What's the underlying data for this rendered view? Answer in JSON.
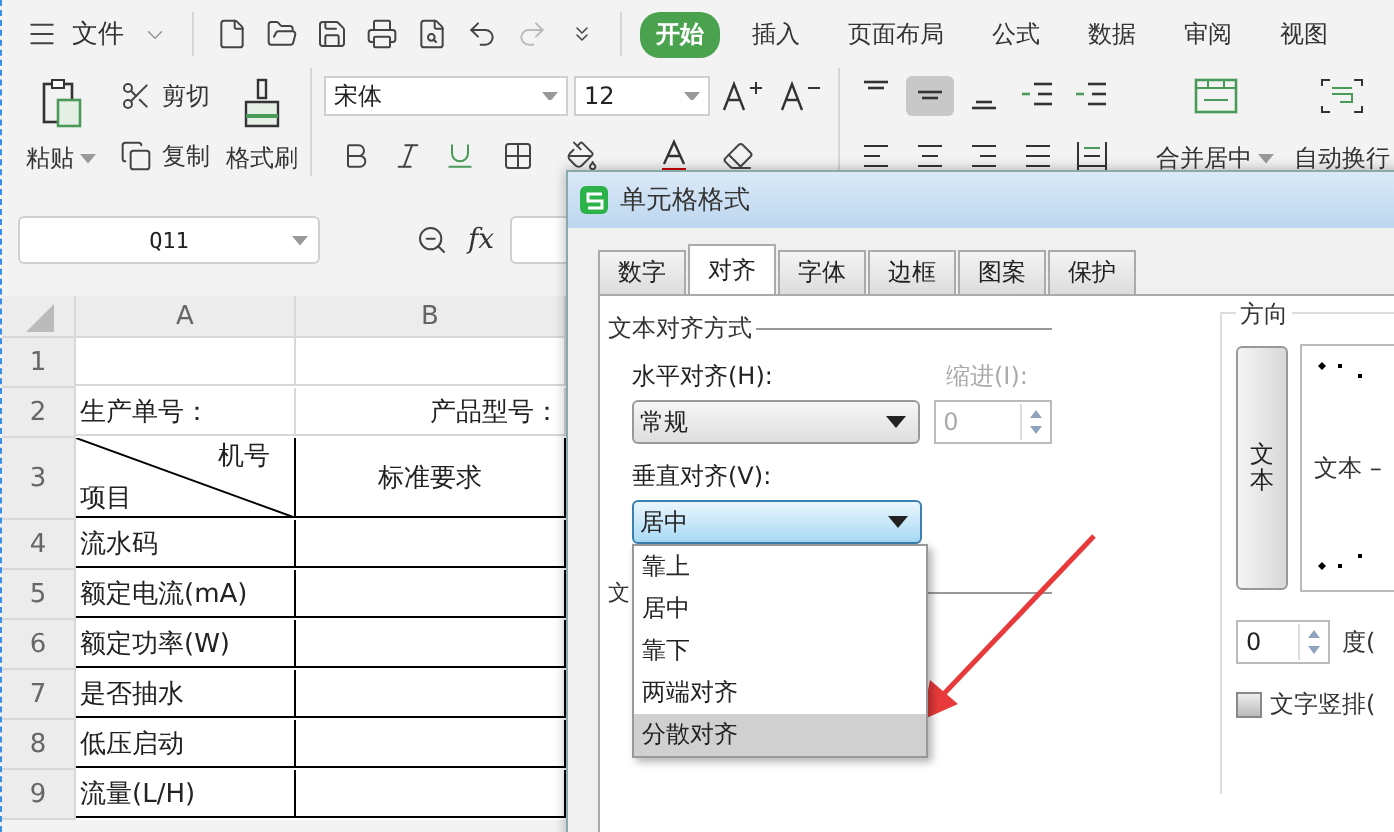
{
  "menu": {
    "file": "文件",
    "tabs": [
      {
        "label": "开始",
        "selected": true
      },
      {
        "label": "插入",
        "selected": false
      },
      {
        "label": "页面布局",
        "selected": false
      },
      {
        "label": "公式",
        "selected": false
      },
      {
        "label": "数据",
        "selected": false
      },
      {
        "label": "审阅",
        "selected": false
      },
      {
        "label": "视图",
        "selected": false
      }
    ]
  },
  "ribbon": {
    "paste": "粘贴",
    "cut": "剪切",
    "copy": "复制",
    "format_painter": "格式刷",
    "font_name": "宋体",
    "font_size": "12",
    "alignment": [
      {
        "kind": "top",
        "selected": false
      },
      {
        "kind": "middle",
        "selected": true
      },
      {
        "kind": "bottom",
        "selected": false
      },
      {
        "kind": "outdent",
        "selected": false
      },
      {
        "kind": "indent",
        "selected": false
      }
    ],
    "merge": "合并居中",
    "wrap": "自动换行"
  },
  "formula_bar": {
    "cell_ref": "Q11",
    "fx": "fx"
  },
  "sheet": {
    "columns": [
      "A",
      "B"
    ],
    "rows": [
      {
        "number": "1",
        "bordered": false
      },
      {
        "number": "2",
        "bordered": false,
        "a": "生产单号：",
        "b": "产品型号："
      },
      {
        "number": "3",
        "bordered": true,
        "kind": "diagonal",
        "a_top": "机号",
        "a_bottom": "项目",
        "b": "标准要求"
      },
      {
        "number": "4",
        "bordered": true,
        "a": "流水码"
      },
      {
        "number": "5",
        "bordered": true,
        "a": "额定电流(mA)"
      },
      {
        "number": "6",
        "bordered": true,
        "a": "额定功率(W)"
      },
      {
        "number": "7",
        "bordered": true,
        "a": "是否抽水"
      },
      {
        "number": "8",
        "bordered": true,
        "a": "低压启动"
      },
      {
        "number": "9",
        "bordered": true,
        "a": "流量(L/H)"
      }
    ]
  },
  "dialog": {
    "title": "单元格格式",
    "tabs": [
      {
        "label": "数字",
        "selected": false
      },
      {
        "label": "对齐",
        "selected": true
      },
      {
        "label": "字体",
        "selected": false
      },
      {
        "label": "边框",
        "selected": false
      },
      {
        "label": "图案",
        "selected": false
      },
      {
        "label": "保护",
        "selected": false
      }
    ],
    "text_alignment": {
      "heading": "文本对齐方式",
      "horizontal_label": "水平对齐(H):",
      "horizontal_value": "常规",
      "indent_label": "缩进(I):",
      "indent_value": "0",
      "indent_disabled": true,
      "vertical_label": "垂直对齐(V):",
      "vertical_value": "居中",
      "vertical_options": [
        {
          "label": "靠上",
          "selected": false
        },
        {
          "label": "居中",
          "selected": false
        },
        {
          "label": "靠下",
          "selected": false
        },
        {
          "label": "两端对齐",
          "selected": false
        },
        {
          "label": "分散对齐",
          "selected": true
        }
      ]
    },
    "text_control": {
      "heading": "文"
    },
    "orientation": {
      "heading": "方向",
      "vertical_text": "文本",
      "preview_text": "文本 –",
      "degrees_value": "0",
      "degrees_label": "度(",
      "stacked_label": "文字竖排(",
      "stacked_checked": false
    }
  }
}
